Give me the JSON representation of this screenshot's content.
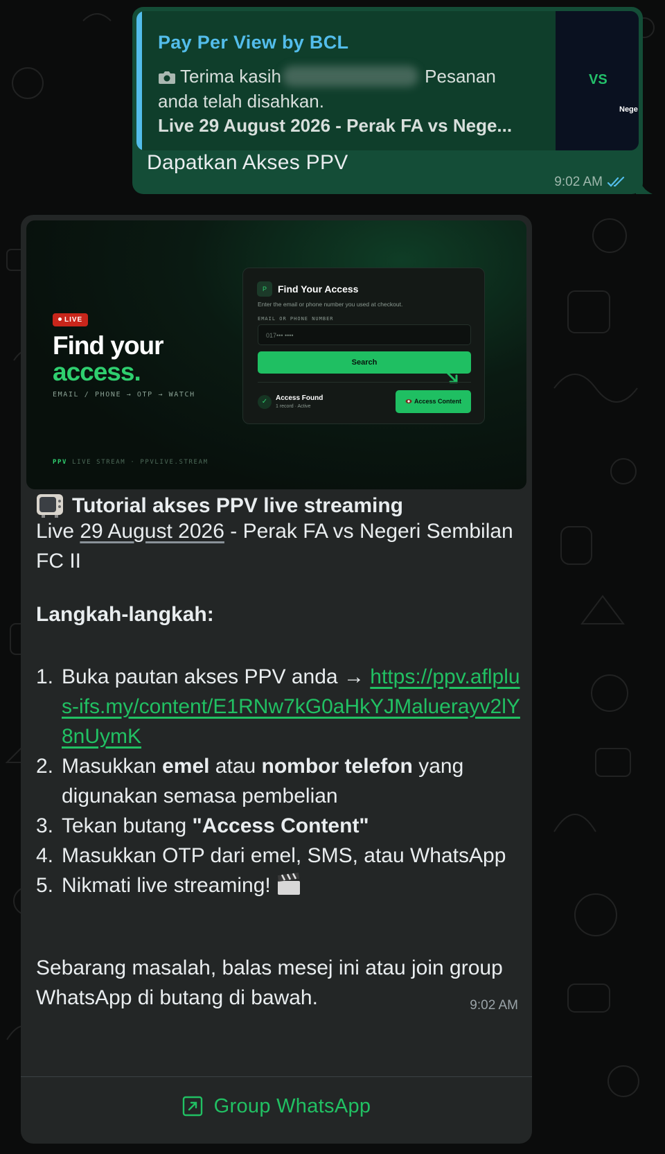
{
  "colors": {
    "outgoing_bubble": "#144d37",
    "incoming_bubble": "#232626",
    "link_green": "#21c063",
    "quote_author_blue": "#53bdeb",
    "ticks_blue": "#53bdeb"
  },
  "outgoing_message": {
    "quote": {
      "author": "Pay Per View by BCL",
      "icon": "camera-icon",
      "text_before_blur": "Terima kasih",
      "text_after_blur": "Pesanan anda telah disahkan.",
      "event": "Live 29 August 2026 - Perak FA vs Nege...",
      "thumbnail": {
        "vs_label": "VS",
        "team_label": "Nege"
      }
    },
    "text": "Dapatkan Akses PPV",
    "time": "9:02 AM",
    "status_icon": "double-check-icon"
  },
  "incoming_message": {
    "preview_image": {
      "live_badge": "LIVE",
      "hero_line1": "Find your",
      "hero_line2": "access.",
      "hero_sub": "EMAIL / PHONE → OTP → WATCH",
      "footer_brand": "PPV",
      "footer_text": "LIVE STREAM · PPVLIVE.STREAM",
      "card": {
        "icon_letter": "P",
        "title": "Find Your Access",
        "description": "Enter the email or phone number you used at checkout.",
        "field_label": "EMAIL OR PHONE NUMBER",
        "field_value": "017••• ••••",
        "search_button": "Search",
        "found_title": "Access Found",
        "found_sub": "1 record · Active",
        "access_button": "Access Content"
      }
    },
    "title_emoji": "television-icon",
    "title": "Tutorial akses PPV live streaming",
    "event_line_prefix": "Live ",
    "event_date": "29 August 2026",
    "event_line_suffix": " - Perak FA vs Negeri Sembilan FC II",
    "steps_heading": "Langkah-langkah:",
    "steps": [
      {
        "num": "1.",
        "before": "Buka pautan akses PPV anda → ",
        "link": "https://ppv.aflplus-ifs.my/content/E1RNw7kG0aHkYJMaluerayv2lY8nUymK"
      },
      {
        "num": "2.",
        "p1": "Masukkan ",
        "b1": "emel",
        "p2": " atau ",
        "b2": "nombor telefon",
        "p3": " yang digunakan semasa pembelian"
      },
      {
        "num": "3.",
        "p1": "Tekan butang ",
        "b1": "\"Access Content\""
      },
      {
        "num": "4.",
        "text": "Masukkan OTP dari emel, SMS, atau WhatsApp"
      },
      {
        "num": "5.",
        "text": "Nikmati live streaming! ",
        "emoji": "clapper-board-icon"
      }
    ],
    "closing": "Sebarang masalah, balas mesej ini atau join group WhatsApp di butang di bawah.",
    "time": "9:02 AM",
    "cta_button": "Group WhatsApp",
    "cta_icon": "external-link-icon"
  }
}
